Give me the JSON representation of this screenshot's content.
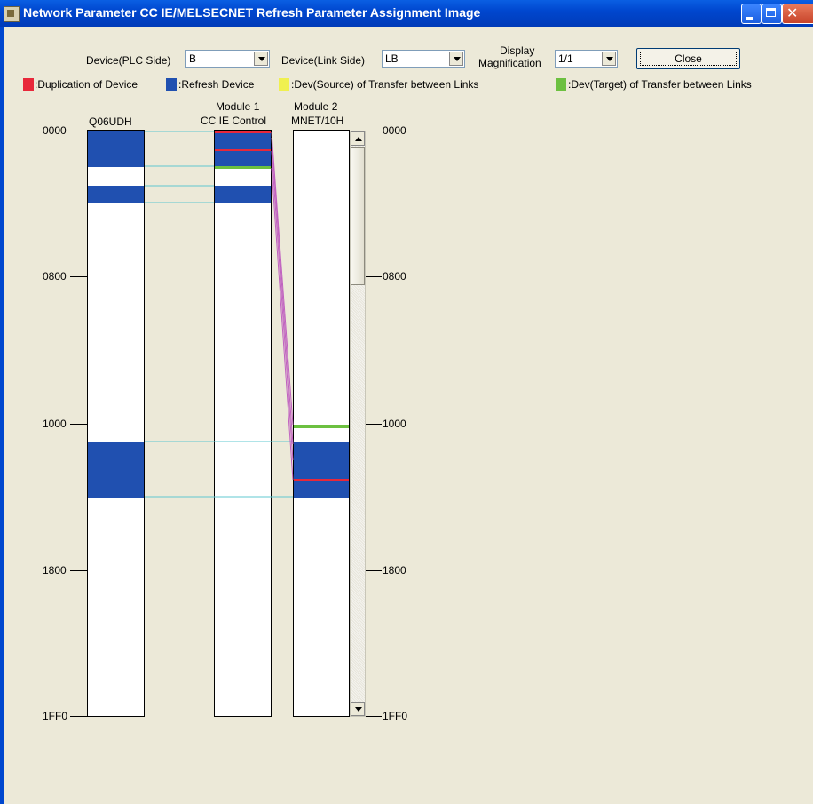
{
  "window": {
    "title": "Network Parameter  CC IE/MELSECNET Refresh Parameter Assignment Image"
  },
  "controls": {
    "plc_side_label": "Device(PLC Side)",
    "plc_side_value": "B",
    "link_side_label": "Device(Link Side)",
    "link_side_value": "LB",
    "display_label_1": "Display",
    "display_label_2": "Magnification",
    "display_value": "1/1",
    "close_label": "Close"
  },
  "legend": [
    {
      "text": ":Duplication of Device",
      "color": "#e8283a"
    },
    {
      "text": ":Refresh Device",
      "color": "#2050b0"
    },
    {
      "text": ":Dev(Source) of Transfer between Links",
      "color": "#f0f050"
    },
    {
      "text": ":Dev(Target) of Transfer between Links",
      "color": "#6cc040"
    }
  ],
  "columns": {
    "cpu_name": "Q06UDH",
    "module1_line1": "Module 1",
    "module1_line2": "CC IE Control",
    "module2_line1": "Module 2",
    "module2_line2": "MNET/10H"
  },
  "left_axis": [
    "0000",
    "0800",
    "1000",
    "1800",
    "1FF0"
  ],
  "right_axis": [
    "0000",
    "0800",
    "1000",
    "1800",
    "1FF0"
  ],
  "colors": {
    "refresh": "#2050b0",
    "duplication": "#e8283a",
    "target": "#6cc040",
    "link_line": "#60c8d0",
    "transfer_line": "#c060c0"
  }
}
